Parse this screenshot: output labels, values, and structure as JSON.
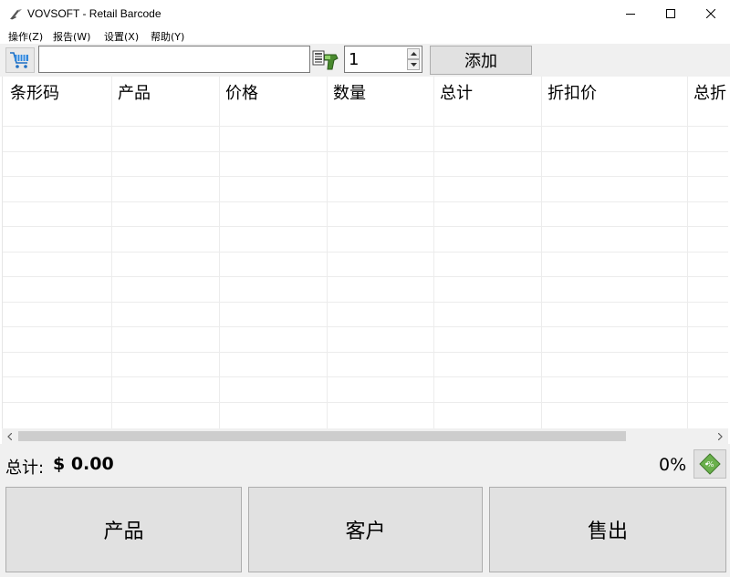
{
  "window": {
    "title": "VOVSOFT - Retail Barcode",
    "app_icon": "vovsoft-logo-icon"
  },
  "menu": [
    {
      "label": "操作(Z)"
    },
    {
      "label": "报告(W)"
    },
    {
      "label": "设置(X)"
    },
    {
      "label": "帮助(Y)"
    }
  ],
  "toolbar": {
    "cart_icon": "cart-icon",
    "barcode_value": "",
    "barcode_placeholder": "",
    "scanner_icon": "barcode-scanner-icon",
    "quantity": "1",
    "add_label": "添加"
  },
  "table": {
    "columns": [
      "条形码",
      "产品",
      "价格",
      "数量",
      "总计",
      "折扣价",
      "总折"
    ],
    "rows": []
  },
  "status": {
    "total_label": "总计:",
    "total_value": "$ 0.00",
    "discount_value": "0%",
    "tag_icon": "discount-tag-icon"
  },
  "buttons": {
    "products": "产品",
    "customers": "客户",
    "sell": "售出"
  },
  "colors": {
    "toolbar_bg": "#f0f0f0",
    "button_bg": "#e1e1e1",
    "tag_green": "#6ab04c"
  }
}
